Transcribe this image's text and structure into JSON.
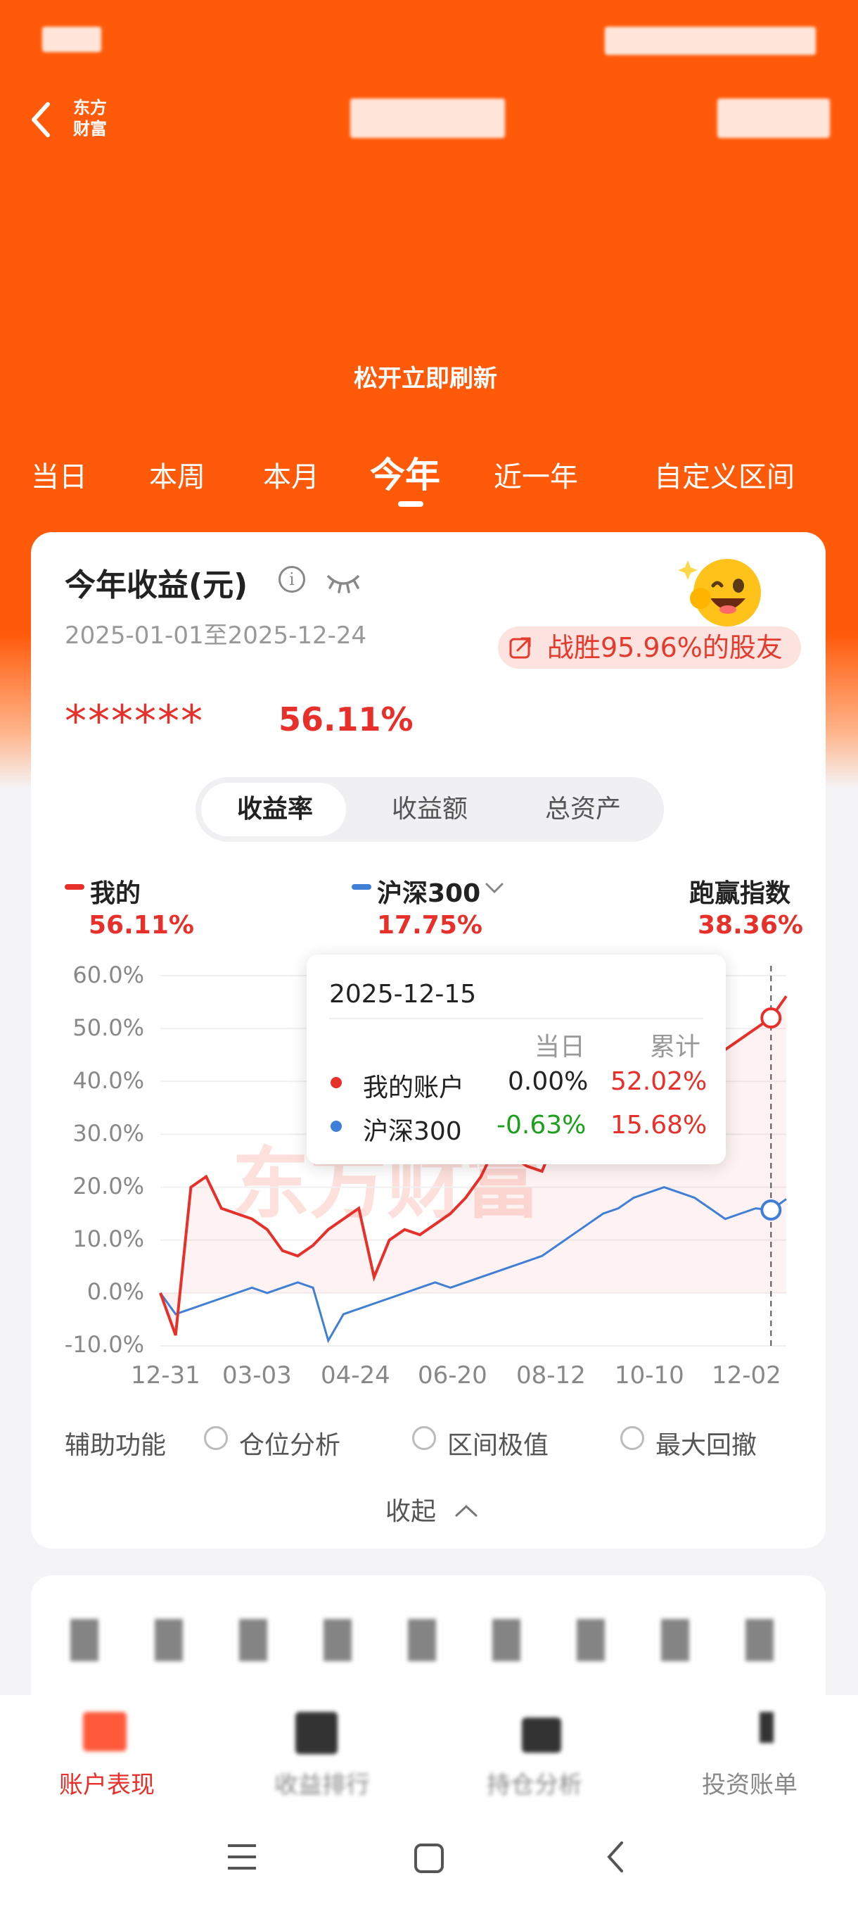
{
  "header": {
    "brand_line1": "东方",
    "brand_line2": "财富",
    "refresh_hint": "松开立即刷新"
  },
  "tabs": [
    "当日",
    "本周",
    "本月",
    "今年",
    "近一年",
    "自定义区间"
  ],
  "active_tab": "今年",
  "card": {
    "title": "今年收益(元)",
    "date_range": "2025-01-01至2025-12-24",
    "beat_text": "战胜95.96%的股友",
    "hidden_amount": "******",
    "return_pct": "56.11%"
  },
  "segments": [
    "收益率",
    "收益额",
    "总资产"
  ],
  "legend": {
    "mine_name": "我的",
    "mine_value": "56.11%",
    "index_name": "沪深300",
    "index_value": "17.75%",
    "beat_name": "跑赢指数",
    "beat_value": "38.36%"
  },
  "tooltip": {
    "date": "2025-12-15",
    "col_day": "当日",
    "col_cum": "累计",
    "row1_name": "我的账户",
    "row1_day": "0.00%",
    "row1_cum": "52.02%",
    "row2_name": "沪深300",
    "row2_day": "-0.63%",
    "row2_cum": "15.68%"
  },
  "watermark": "东方财富",
  "aux": {
    "label": "辅助功能",
    "opt1": "仓位分析",
    "opt2": "区间极值",
    "opt3": "最大回撤",
    "collapse": "收起"
  },
  "bottom_nav": [
    "账户表现",
    "收益排行",
    "持仓分析",
    "投资账单"
  ],
  "colors": {
    "brand_orange": "#ff5a0a",
    "mine_red": "#e8302a",
    "index_blue": "#3f7fd6",
    "green": "#1aa01a"
  },
  "chart_data": {
    "type": "line",
    "x_ticks": [
      "12-31",
      "03-03",
      "04-24",
      "06-20",
      "08-12",
      "10-10",
      "12-02"
    ],
    "y_ticks": [
      "60.0%",
      "50.0%",
      "40.0%",
      "30.0%",
      "20.0%",
      "10.0%",
      "0.0%",
      "-10.0%"
    ],
    "ylim": [
      -10,
      60
    ],
    "series": [
      {
        "name": "我的",
        "color": "#e8302a",
        "values": [
          0,
          -8,
          20,
          22,
          16,
          15,
          14,
          12,
          8,
          7,
          9,
          12,
          14,
          16,
          3,
          10,
          12,
          11,
          13,
          15,
          18,
          22,
          28,
          26,
          24,
          23,
          30,
          31,
          31,
          33,
          35,
          34,
          36,
          38,
          40,
          42,
          44,
          46,
          48,
          50,
          52,
          56.11
        ]
      },
      {
        "name": "沪深300",
        "color": "#3f7fd6",
        "values": [
          0,
          -4,
          -3,
          -2,
          -1,
          0,
          1,
          0,
          1,
          2,
          1,
          -9,
          -4,
          -3,
          -2,
          -1,
          0,
          1,
          2,
          1,
          2,
          3,
          4,
          5,
          6,
          7,
          9,
          11,
          13,
          15,
          16,
          18,
          19,
          20,
          19,
          18,
          16,
          14,
          15,
          16,
          15.68,
          17.75
        ]
      }
    ]
  }
}
